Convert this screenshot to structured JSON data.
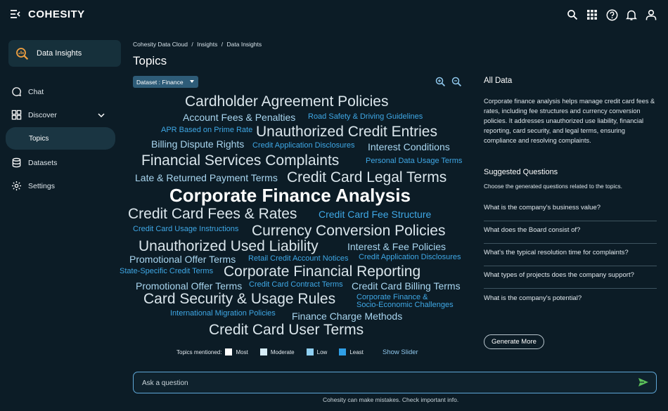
{
  "app": {
    "brand": "COHESITY"
  },
  "sidebar": {
    "card_label": "Data Insights",
    "items": [
      {
        "label": "Chat",
        "icon": "chat-icon"
      },
      {
        "label": "Discover",
        "icon": "discover-icon"
      },
      {
        "label": "Topics"
      },
      {
        "label": "Datasets",
        "icon": "datasets-icon"
      },
      {
        "label": "Settings",
        "icon": "gear-icon"
      }
    ]
  },
  "breadcrumb": {
    "items": [
      "Cohesity Data Cloud",
      "Insights",
      "Data Insights"
    ],
    "separator": "/"
  },
  "page": {
    "title": "Topics"
  },
  "dataset": {
    "label": "Dataset : Finance"
  },
  "cloud": {
    "words": [
      "Cardholder Agreement Policies",
      "Account Fees & Penalties",
      "Road Safety & Driving Guidelines",
      "APR Based on Prime Rate",
      "Unauthorized Credit Entries",
      "Billing Dispute Rights",
      "Credit Application Disclosures",
      "Interest Conditions",
      "Financial Services Complaints",
      "Personal Data Usage Terms",
      "Late & Returned Payment Terms",
      "Credit Card Legal Terms",
      "Corporate Finance Analysis",
      "Credit Card Fees & Rates",
      "Credit Card Fee Structure",
      "Credit Card Usage Instructions",
      "Currency Conversion Policies",
      "Unauthorized Used Liability",
      "Interest & Fee Policies",
      "Promotional Offer Terms",
      "Retail Credit Account Notices",
      "Credit Application Disclosures",
      "State-Specific Credit Terms",
      "Corporate Financial Reporting",
      "Promotional Offer Terms",
      "Credit Card Contract Terms",
      "Credit Card Billing Terms",
      "Card Security & Usage Rules",
      "Corporate Finance &",
      "Socio-Economic Challenges",
      "International Migration Policies",
      "Finance Charge Methods",
      "Credit Card User Terms"
    ]
  },
  "legend": {
    "label": "Topics mentioned:",
    "items": [
      {
        "label": "Most",
        "color": "#ffffff"
      },
      {
        "label": "Moderate",
        "color": "#d6ecf7"
      },
      {
        "label": "Low",
        "color": "#8fd0f2"
      },
      {
        "label": "Least",
        "color": "#2f9fe6"
      }
    ],
    "show_slider": "Show Slider"
  },
  "right_panel": {
    "title": "All Data",
    "description": "Corporate finance analysis helps manage credit card fees & rates, including fee structures and currency conversion policies. It addresses unauthorized use liability, financial reporting, card security, and legal terms, ensuring compliance and resolving complaints.",
    "suggested_title": "Suggested Questions",
    "suggested_sub": "Choose the generated questions related to the topics.",
    "questions": [
      "What is the company's business value?",
      "What does the Board consist of?",
      "What's the typical resolution time for complaints?",
      "What types of projects does the company support?",
      "What is the company's potential?"
    ],
    "generate_more": "Generate More"
  },
  "ask": {
    "placeholder": "Ask a question"
  },
  "disclaimer": "Cohesity can make mistakes. Check important info.",
  "colors": {
    "background": "#0c1c26",
    "accent": "#3fa8e6",
    "send": "#5cc15a"
  }
}
